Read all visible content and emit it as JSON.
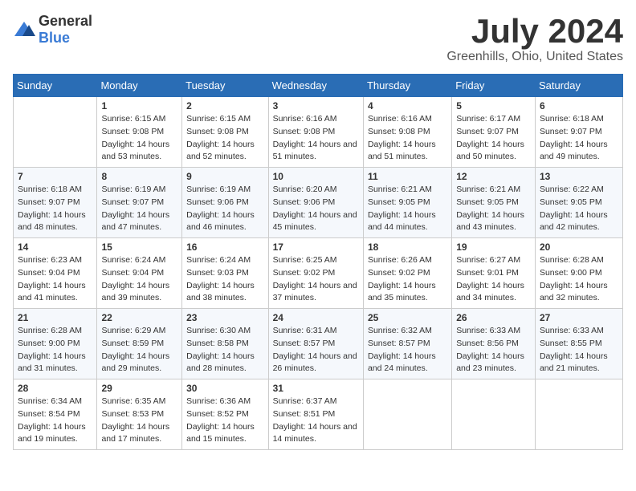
{
  "logo": {
    "general": "General",
    "blue": "Blue"
  },
  "title": "July 2024",
  "subtitle": "Greenhills, Ohio, United States",
  "days_of_week": [
    "Sunday",
    "Monday",
    "Tuesday",
    "Wednesday",
    "Thursday",
    "Friday",
    "Saturday"
  ],
  "weeks": [
    [
      {
        "day": "",
        "sunrise": "",
        "sunset": "",
        "daylight": ""
      },
      {
        "day": "1",
        "sunrise": "Sunrise: 6:15 AM",
        "sunset": "Sunset: 9:08 PM",
        "daylight": "Daylight: 14 hours and 53 minutes."
      },
      {
        "day": "2",
        "sunrise": "Sunrise: 6:15 AM",
        "sunset": "Sunset: 9:08 PM",
        "daylight": "Daylight: 14 hours and 52 minutes."
      },
      {
        "day": "3",
        "sunrise": "Sunrise: 6:16 AM",
        "sunset": "Sunset: 9:08 PM",
        "daylight": "Daylight: 14 hours and 51 minutes."
      },
      {
        "day": "4",
        "sunrise": "Sunrise: 6:16 AM",
        "sunset": "Sunset: 9:08 PM",
        "daylight": "Daylight: 14 hours and 51 minutes."
      },
      {
        "day": "5",
        "sunrise": "Sunrise: 6:17 AM",
        "sunset": "Sunset: 9:07 PM",
        "daylight": "Daylight: 14 hours and 50 minutes."
      },
      {
        "day": "6",
        "sunrise": "Sunrise: 6:18 AM",
        "sunset": "Sunset: 9:07 PM",
        "daylight": "Daylight: 14 hours and 49 minutes."
      }
    ],
    [
      {
        "day": "7",
        "sunrise": "Sunrise: 6:18 AM",
        "sunset": "Sunset: 9:07 PM",
        "daylight": "Daylight: 14 hours and 48 minutes."
      },
      {
        "day": "8",
        "sunrise": "Sunrise: 6:19 AM",
        "sunset": "Sunset: 9:07 PM",
        "daylight": "Daylight: 14 hours and 47 minutes."
      },
      {
        "day": "9",
        "sunrise": "Sunrise: 6:19 AM",
        "sunset": "Sunset: 9:06 PM",
        "daylight": "Daylight: 14 hours and 46 minutes."
      },
      {
        "day": "10",
        "sunrise": "Sunrise: 6:20 AM",
        "sunset": "Sunset: 9:06 PM",
        "daylight": "Daylight: 14 hours and 45 minutes."
      },
      {
        "day": "11",
        "sunrise": "Sunrise: 6:21 AM",
        "sunset": "Sunset: 9:05 PM",
        "daylight": "Daylight: 14 hours and 44 minutes."
      },
      {
        "day": "12",
        "sunrise": "Sunrise: 6:21 AM",
        "sunset": "Sunset: 9:05 PM",
        "daylight": "Daylight: 14 hours and 43 minutes."
      },
      {
        "day": "13",
        "sunrise": "Sunrise: 6:22 AM",
        "sunset": "Sunset: 9:05 PM",
        "daylight": "Daylight: 14 hours and 42 minutes."
      }
    ],
    [
      {
        "day": "14",
        "sunrise": "Sunrise: 6:23 AM",
        "sunset": "Sunset: 9:04 PM",
        "daylight": "Daylight: 14 hours and 41 minutes."
      },
      {
        "day": "15",
        "sunrise": "Sunrise: 6:24 AM",
        "sunset": "Sunset: 9:04 PM",
        "daylight": "Daylight: 14 hours and 39 minutes."
      },
      {
        "day": "16",
        "sunrise": "Sunrise: 6:24 AM",
        "sunset": "Sunset: 9:03 PM",
        "daylight": "Daylight: 14 hours and 38 minutes."
      },
      {
        "day": "17",
        "sunrise": "Sunrise: 6:25 AM",
        "sunset": "Sunset: 9:02 PM",
        "daylight": "Daylight: 14 hours and 37 minutes."
      },
      {
        "day": "18",
        "sunrise": "Sunrise: 6:26 AM",
        "sunset": "Sunset: 9:02 PM",
        "daylight": "Daylight: 14 hours and 35 minutes."
      },
      {
        "day": "19",
        "sunrise": "Sunrise: 6:27 AM",
        "sunset": "Sunset: 9:01 PM",
        "daylight": "Daylight: 14 hours and 34 minutes."
      },
      {
        "day": "20",
        "sunrise": "Sunrise: 6:28 AM",
        "sunset": "Sunset: 9:00 PM",
        "daylight": "Daylight: 14 hours and 32 minutes."
      }
    ],
    [
      {
        "day": "21",
        "sunrise": "Sunrise: 6:28 AM",
        "sunset": "Sunset: 9:00 PM",
        "daylight": "Daylight: 14 hours and 31 minutes."
      },
      {
        "day": "22",
        "sunrise": "Sunrise: 6:29 AM",
        "sunset": "Sunset: 8:59 PM",
        "daylight": "Daylight: 14 hours and 29 minutes."
      },
      {
        "day": "23",
        "sunrise": "Sunrise: 6:30 AM",
        "sunset": "Sunset: 8:58 PM",
        "daylight": "Daylight: 14 hours and 28 minutes."
      },
      {
        "day": "24",
        "sunrise": "Sunrise: 6:31 AM",
        "sunset": "Sunset: 8:57 PM",
        "daylight": "Daylight: 14 hours and 26 minutes."
      },
      {
        "day": "25",
        "sunrise": "Sunrise: 6:32 AM",
        "sunset": "Sunset: 8:57 PM",
        "daylight": "Daylight: 14 hours and 24 minutes."
      },
      {
        "day": "26",
        "sunrise": "Sunrise: 6:33 AM",
        "sunset": "Sunset: 8:56 PM",
        "daylight": "Daylight: 14 hours and 23 minutes."
      },
      {
        "day": "27",
        "sunrise": "Sunrise: 6:33 AM",
        "sunset": "Sunset: 8:55 PM",
        "daylight": "Daylight: 14 hours and 21 minutes."
      }
    ],
    [
      {
        "day": "28",
        "sunrise": "Sunrise: 6:34 AM",
        "sunset": "Sunset: 8:54 PM",
        "daylight": "Daylight: 14 hours and 19 minutes."
      },
      {
        "day": "29",
        "sunrise": "Sunrise: 6:35 AM",
        "sunset": "Sunset: 8:53 PM",
        "daylight": "Daylight: 14 hours and 17 minutes."
      },
      {
        "day": "30",
        "sunrise": "Sunrise: 6:36 AM",
        "sunset": "Sunset: 8:52 PM",
        "daylight": "Daylight: 14 hours and 15 minutes."
      },
      {
        "day": "31",
        "sunrise": "Sunrise: 6:37 AM",
        "sunset": "Sunset: 8:51 PM",
        "daylight": "Daylight: 14 hours and 14 minutes."
      },
      {
        "day": "",
        "sunrise": "",
        "sunset": "",
        "daylight": ""
      },
      {
        "day": "",
        "sunrise": "",
        "sunset": "",
        "daylight": ""
      },
      {
        "day": "",
        "sunrise": "",
        "sunset": "",
        "daylight": ""
      }
    ]
  ]
}
